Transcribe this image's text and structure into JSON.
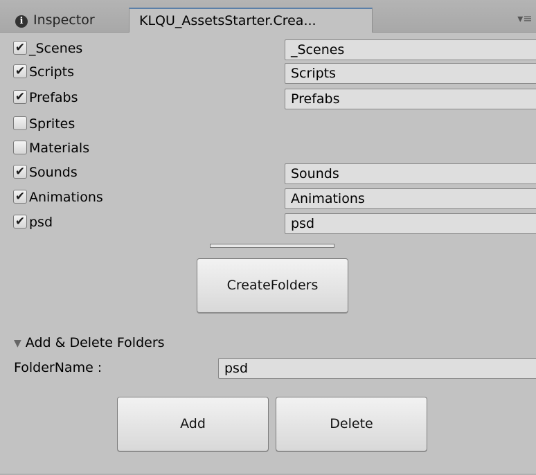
{
  "tabs": {
    "inspector_label": "Inspector",
    "active_label": "KLQU_AssetsStarter.Crea...",
    "menu_glyph": "▾≡"
  },
  "folders": [
    {
      "label": "_Scenes",
      "checked": true,
      "value": "_Scenes"
    },
    {
      "label": "Scripts",
      "checked": true,
      "value": "Scripts"
    },
    {
      "label": "Prefabs",
      "checked": true,
      "value": "Prefabs"
    },
    {
      "label": "Sprites",
      "checked": false,
      "value": null
    },
    {
      "label": "Materials",
      "checked": false,
      "value": null
    },
    {
      "label": "Sounds",
      "checked": true,
      "value": "Sounds"
    },
    {
      "label": "Animations",
      "checked": true,
      "value": "Animations"
    },
    {
      "label": "psd",
      "checked": true,
      "value": "psd"
    }
  ],
  "create_button_label": "CreateFolders",
  "foldout": {
    "label": "Add & Delete Folders",
    "expanded": true
  },
  "folder_name": {
    "label": "FolderName :",
    "value": "psd"
  },
  "add_button_label": "Add",
  "delete_button_label": "Delete"
}
